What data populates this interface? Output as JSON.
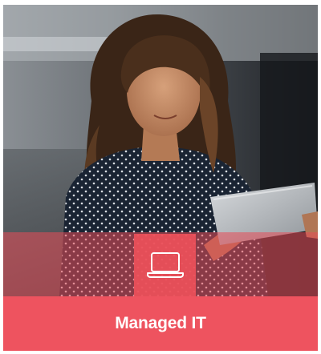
{
  "card": {
    "title": "Managed IT",
    "icon": "laptop-icon",
    "photo": "woman-with-tablet-photo"
  },
  "colors": {
    "accent": "#EE535F",
    "overlay": "#E84C58"
  }
}
